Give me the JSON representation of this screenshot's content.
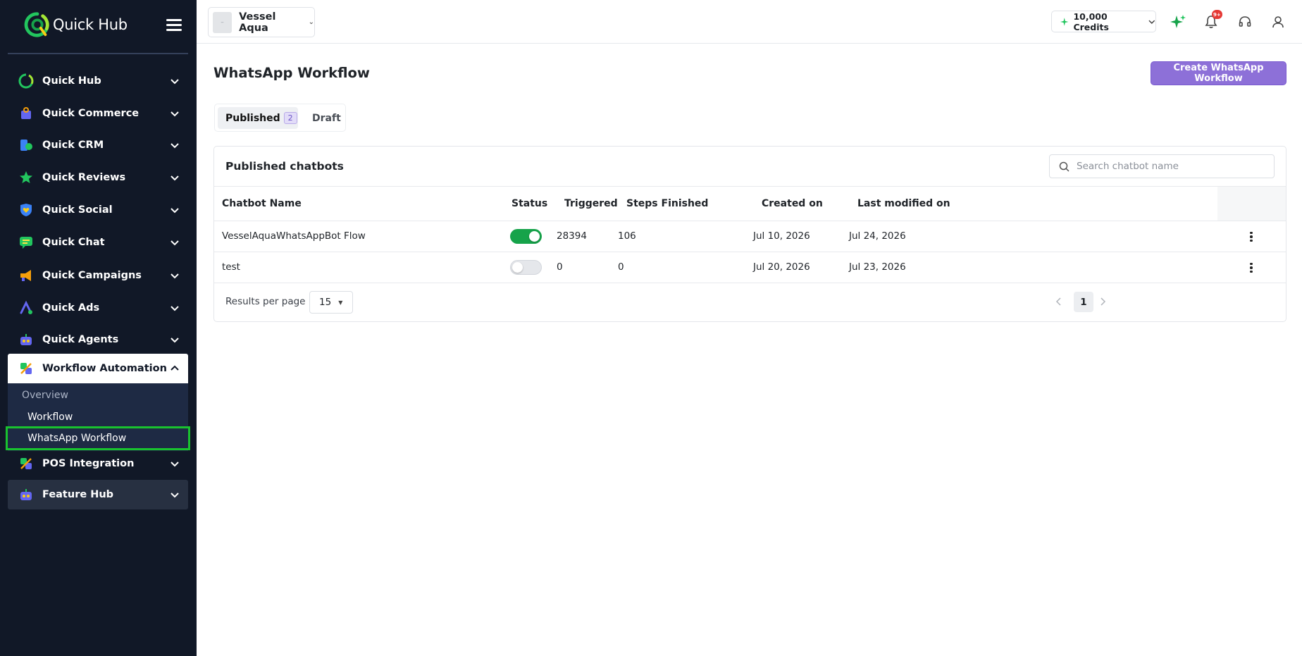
{
  "brand": {
    "name": "Quick Hub"
  },
  "sidebar": {
    "items": [
      {
        "label": "Quick Hub"
      },
      {
        "label": "Quick Commerce"
      },
      {
        "label": "Quick CRM"
      },
      {
        "label": "Quick Reviews"
      },
      {
        "label": "Quick Social"
      },
      {
        "label": "Quick Chat"
      },
      {
        "label": "Quick Campaigns"
      },
      {
        "label": "Quick Ads"
      },
      {
        "label": "Quick Agents"
      },
      {
        "label": "Workflow Automation"
      },
      {
        "label": "POS Integration"
      },
      {
        "label": "Feature Hub"
      }
    ],
    "submenu": [
      {
        "label": "Overview"
      },
      {
        "label": "Workflow"
      },
      {
        "label": "WhatsApp Workflow"
      }
    ]
  },
  "topbar": {
    "store_name": "Vessel Aqua",
    "credits": "10,000 Credits",
    "notification_badge": "9+"
  },
  "page": {
    "title": "WhatsApp Workflow",
    "create_button": "Create WhatsApp Workflow",
    "tabs": [
      {
        "label": "Published",
        "count": "2"
      },
      {
        "label": "Draft"
      }
    ]
  },
  "card": {
    "title": "Published chatbots",
    "search_placeholder": "Search chatbot name",
    "columns": [
      "Chatbot Name",
      "Status",
      "Triggered",
      "Steps Finished",
      "Created on",
      "Last modified on"
    ],
    "rows": [
      {
        "name": "VesselAquaWhatsAppBot Flow",
        "status": "on",
        "triggered": "28394",
        "steps_finished": "106",
        "created_on": "Jul 10, 2026",
        "last_modified": "Jul 24, 2026"
      },
      {
        "name": "test",
        "status": "off",
        "triggered": "0",
        "steps_finished": "0",
        "created_on": "Jul 20, 2026",
        "last_modified": "Jul 23, 2026"
      }
    ],
    "footer": {
      "results_label": "Results per page",
      "per_page": "15",
      "current_page": "1"
    }
  },
  "colors": {
    "sidebar_bg": "#111827",
    "accent_purple": "#8d70d8",
    "toggle_on": "#16a34a",
    "highlight_green": "#19c22f"
  }
}
